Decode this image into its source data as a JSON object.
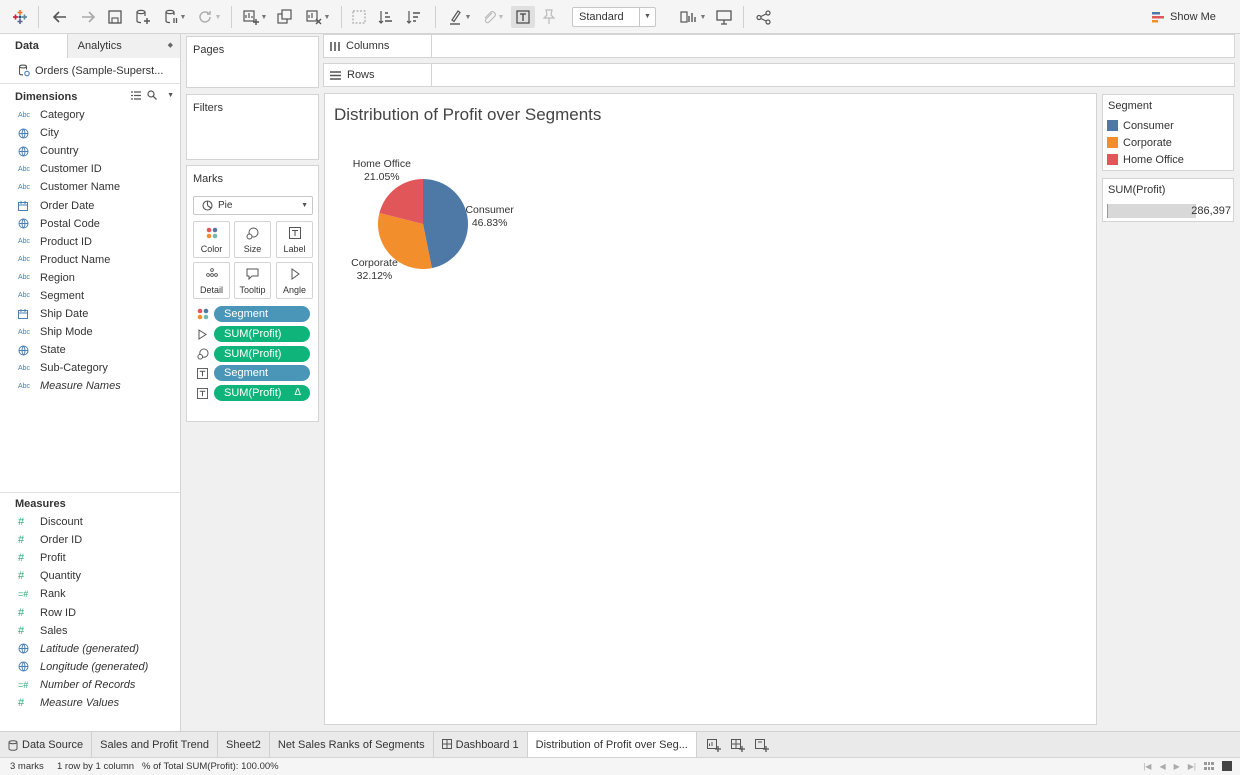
{
  "toolbar": {
    "view_mode": "Standard",
    "show_me_label": "Show Me"
  },
  "data_pane": {
    "tabs": [
      {
        "label": "Data",
        "active": true
      },
      {
        "label": "Analytics",
        "active": false
      }
    ],
    "datasource": "Orders (Sample-Superst...",
    "dimensions_label": "Dimensions",
    "dimensions": [
      {
        "label": "Category",
        "type": "Abc"
      },
      {
        "label": "City",
        "type": "geo"
      },
      {
        "label": "Country",
        "type": "geo"
      },
      {
        "label": "Customer ID",
        "type": "Abc"
      },
      {
        "label": "Customer Name",
        "type": "Abc"
      },
      {
        "label": "Order Date",
        "type": "date"
      },
      {
        "label": "Postal Code",
        "type": "geo"
      },
      {
        "label": "Product ID",
        "type": "Abc"
      },
      {
        "label": "Product Name",
        "type": "Abc"
      },
      {
        "label": "Region",
        "type": "Abc"
      },
      {
        "label": "Segment",
        "type": "Abc"
      },
      {
        "label": "Ship Date",
        "type": "date"
      },
      {
        "label": "Ship Mode",
        "type": "Abc"
      },
      {
        "label": "State",
        "type": "geo"
      },
      {
        "label": "Sub-Category",
        "type": "Abc"
      },
      {
        "label": "Measure Names",
        "type": "Abc",
        "italic": true
      }
    ],
    "measures_label": "Measures",
    "measures": [
      {
        "label": "Discount",
        "type": "#"
      },
      {
        "label": "Order ID",
        "type": "#"
      },
      {
        "label": "Profit",
        "type": "#"
      },
      {
        "label": "Quantity",
        "type": "#"
      },
      {
        "label": "Rank",
        "type": "=#"
      },
      {
        "label": "Row ID",
        "type": "#"
      },
      {
        "label": "Sales",
        "type": "#"
      },
      {
        "label": "Latitude (generated)",
        "type": "geo",
        "italic": true
      },
      {
        "label": "Longitude (generated)",
        "type": "geo",
        "italic": true
      },
      {
        "label": "Number of Records",
        "type": "=#",
        "italic": true
      },
      {
        "label": "Measure Values",
        "type": "#",
        "italic": true
      }
    ]
  },
  "cards": {
    "pages": "Pages",
    "filters": "Filters",
    "marks": "Marks",
    "mark_type": "Pie",
    "mark_buttons": [
      "Color",
      "Size",
      "Label",
      "Detail",
      "Tooltip",
      "Angle"
    ],
    "mark_pills": [
      {
        "label": "Segment",
        "kind": "dim",
        "icon": "color"
      },
      {
        "label": "SUM(Profit)",
        "kind": "meas",
        "icon": "angle"
      },
      {
        "label": "SUM(Profit)",
        "kind": "meas",
        "icon": "size"
      },
      {
        "label": "Segment",
        "kind": "dim",
        "icon": "label"
      },
      {
        "label": "SUM(Profit)",
        "kind": "meas",
        "icon": "label",
        "delta": "Δ"
      }
    ]
  },
  "shelves": {
    "columns": "Columns",
    "rows": "Rows"
  },
  "viz": {
    "title": "Distribution of Profit over Segments"
  },
  "chart_data": {
    "type": "pie",
    "title": "Distribution of Profit over Segments",
    "slices": [
      {
        "label": "Consumer",
        "percent": 46.83,
        "percent_label": "46.83%",
        "color": "#4e79a7"
      },
      {
        "label": "Corporate",
        "percent": 32.12,
        "percent_label": "32.12%",
        "color": "#f28e2b"
      },
      {
        "label": "Home Office",
        "percent": 21.05,
        "percent_label": "21.05%",
        "color": "#e15759"
      }
    ]
  },
  "legend": {
    "title": "Segment",
    "items": [
      {
        "label": "Consumer",
        "color": "#4e79a7"
      },
      {
        "label": "Corporate",
        "color": "#f28e2b"
      },
      {
        "label": "Home Office",
        "color": "#e15759"
      }
    ]
  },
  "size_legend": {
    "title": "SUM(Profit)",
    "value": "286,397",
    "fill_fraction": 0.72
  },
  "sheet_tabs": {
    "data_source": "Data Source",
    "tabs": [
      {
        "label": "Sales and Profit Trend",
        "active": false
      },
      {
        "label": "Sheet2",
        "active": false
      },
      {
        "label": "Net Sales Ranks of Segments",
        "active": false
      },
      {
        "label": "Dashboard 1",
        "active": false,
        "dashboard": true
      },
      {
        "label": "Distribution of Profit over Seg...",
        "active": true
      }
    ]
  },
  "status_bar": {
    "marks": "3 marks",
    "rows_cols": "1 row by 1 column",
    "summary": "% of Total SUM(Profit): 100.00%"
  }
}
